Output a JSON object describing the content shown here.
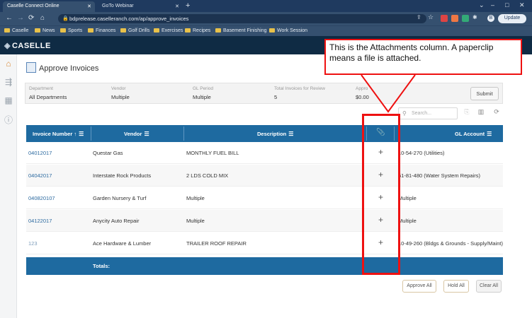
{
  "browser": {
    "tabs": [
      {
        "title": "Caselle Connect Online",
        "active": true
      },
      {
        "title": "GoTo Webinar",
        "active": false
      }
    ],
    "url": "bdprelease.caselleranch.com/ap/approve_invoices",
    "update_label": "Update",
    "profile_letter": "B",
    "bookmarks": [
      "Caselle",
      "News",
      "Sports",
      "Finances",
      "Golf Drills",
      "Exercises",
      "Recipes",
      "Basement Finishing",
      "Work Session"
    ]
  },
  "app": {
    "logo": "CASELLE"
  },
  "page": {
    "title": "Approve Invoices",
    "filters": [
      {
        "label": "Department",
        "value": "All Departments"
      },
      {
        "label": "Vendor",
        "value": "Multiple"
      },
      {
        "label": "GL Period",
        "value": "Multiple"
      },
      {
        "label": "Total Invoices for Review",
        "value": "5"
      },
      {
        "label": "Appro",
        "value": "$0.00"
      }
    ],
    "submit_label": "Submit",
    "search_placeholder": "Search..."
  },
  "table": {
    "columns": [
      "Invoice Number",
      "Vendor",
      "Description",
      "",
      "GL Account"
    ],
    "rows": [
      {
        "invoice": "04012017",
        "vendor": "Questar Gas",
        "description": "MONTHLY FUEL BILL",
        "gl": "10-54-270 (Utilities)"
      },
      {
        "invoice": "04042017",
        "vendor": "Interstate Rock Products",
        "description": "2 LDS COLD MIX",
        "gl": "51-81-480 (Water System Repairs)"
      },
      {
        "invoice": "040820107",
        "vendor": "Garden Nursery & Turf",
        "description": "Multiple",
        "gl": "Multiple"
      },
      {
        "invoice": "04122017",
        "vendor": "Anycity Auto Repair",
        "description": "Multiple",
        "gl": "Multiple"
      },
      {
        "invoice": "123",
        "vendor": "Ace Hardware & Lumber",
        "description": "TRAILER ROOF REPAIR",
        "gl": "10-49-260 (Bldgs & Grounds - Supply/Maint)"
      }
    ],
    "totals_label": "Totals:"
  },
  "actions": {
    "approve_all": "Approve All",
    "hold_all": "Hold All",
    "clear_all": "Clear All"
  },
  "callout": {
    "text": "This is the Attachments column. A paperclip means a file is attached."
  }
}
